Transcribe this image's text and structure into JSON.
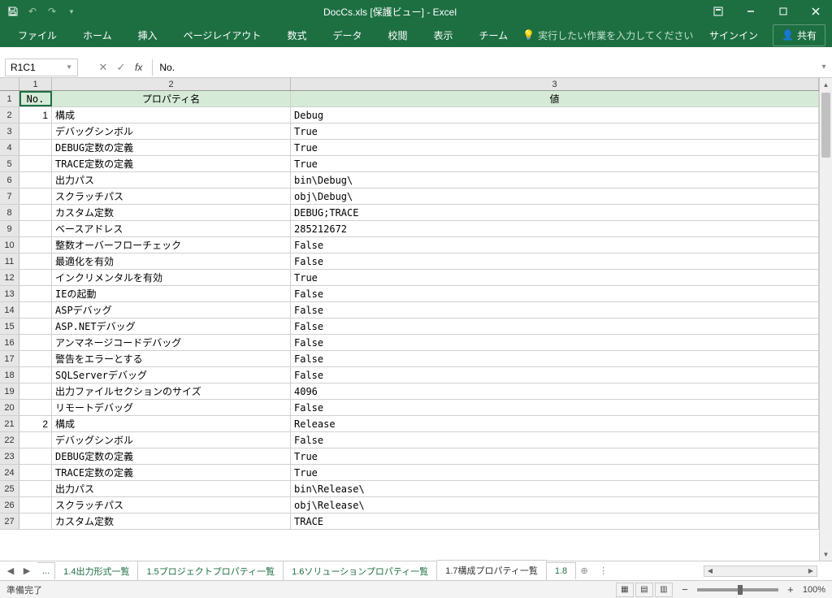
{
  "titlebar": {
    "title": "DocCs.xls  [保護ビュー] - Excel"
  },
  "ribbon": {
    "tabs": [
      "ファイル",
      "ホーム",
      "挿入",
      "ページレイアウト",
      "数式",
      "データ",
      "校閲",
      "表示",
      "チーム"
    ],
    "search_placeholder": "実行したい作業を入力してください",
    "signin": "サインイン",
    "share": "共有"
  },
  "formula_bar": {
    "name_box": "R1C1",
    "fx": "fx",
    "formula": "No."
  },
  "columns": [
    "1",
    "2",
    "3"
  ],
  "header_row": {
    "no": "No.",
    "prop": "プロパティ名",
    "val": "値"
  },
  "rows": [
    {
      "n": "1",
      "no": "1",
      "prop": "構成",
      "val": "Debug"
    },
    {
      "n": "2",
      "no": "",
      "prop": "デバッグシンボル",
      "val": "True"
    },
    {
      "n": "3",
      "no": "",
      "prop": "DEBUG定数の定義",
      "val": "True"
    },
    {
      "n": "4",
      "no": "",
      "prop": "TRACE定数の定義",
      "val": "True"
    },
    {
      "n": "5",
      "no": "",
      "prop": "出力パス",
      "val": "bin\\Debug\\"
    },
    {
      "n": "6",
      "no": "",
      "prop": "スクラッチパス",
      "val": "obj\\Debug\\"
    },
    {
      "n": "7",
      "no": "",
      "prop": "カスタム定数",
      "val": "DEBUG;TRACE"
    },
    {
      "n": "8",
      "no": "",
      "prop": "ベースアドレス",
      "val": "285212672"
    },
    {
      "n": "9",
      "no": "",
      "prop": "整数オーバーフローチェック",
      "val": "False"
    },
    {
      "n": "10",
      "no": "",
      "prop": "最適化を有効",
      "val": "False"
    },
    {
      "n": "11",
      "no": "",
      "prop": "インクリメンタルを有効",
      "val": "True"
    },
    {
      "n": "12",
      "no": "",
      "prop": "IEの起動",
      "val": "False"
    },
    {
      "n": "13",
      "no": "",
      "prop": "ASPデバッグ",
      "val": "False"
    },
    {
      "n": "14",
      "no": "",
      "prop": "ASP.NETデバッグ",
      "val": "False"
    },
    {
      "n": "15",
      "no": "",
      "prop": "アンマネージコードデバッグ",
      "val": "False"
    },
    {
      "n": "16",
      "no": "",
      "prop": "警告をエラーとする",
      "val": "False"
    },
    {
      "n": "17",
      "no": "",
      "prop": "SQLServerデバッグ",
      "val": "False"
    },
    {
      "n": "18",
      "no": "",
      "prop": "出力ファイルセクションのサイズ",
      "val": "4096"
    },
    {
      "n": "19",
      "no": "",
      "prop": "リモートデバッグ",
      "val": "False"
    },
    {
      "n": "20",
      "no": "2",
      "prop": "構成",
      "val": "Release"
    },
    {
      "n": "21",
      "no": "",
      "prop": "デバッグシンボル",
      "val": "False"
    },
    {
      "n": "22",
      "no": "",
      "prop": "DEBUG定数の定義",
      "val": "True"
    },
    {
      "n": "23",
      "no": "",
      "prop": "TRACE定数の定義",
      "val": "True"
    },
    {
      "n": "24",
      "no": "",
      "prop": "出力パス",
      "val": "bin\\Release\\"
    },
    {
      "n": "25",
      "no": "",
      "prop": "スクラッチパス",
      "val": "obj\\Release\\"
    },
    {
      "n": "26",
      "no": "",
      "prop": "カスタム定数",
      "val": "TRACE"
    }
  ],
  "sheet_tabs": {
    "prev_ellipsis": "...",
    "tabs": [
      "1.4出力形式一覧",
      "1.5プロジェクトプロパティ一覧",
      "1.6ソリューションプロパティ一覧",
      "1.7構成プロパティ一覧"
    ],
    "next_partial": "1.8",
    "active_index": 3
  },
  "statusbar": {
    "status": "準備完了",
    "zoom": "100%"
  }
}
